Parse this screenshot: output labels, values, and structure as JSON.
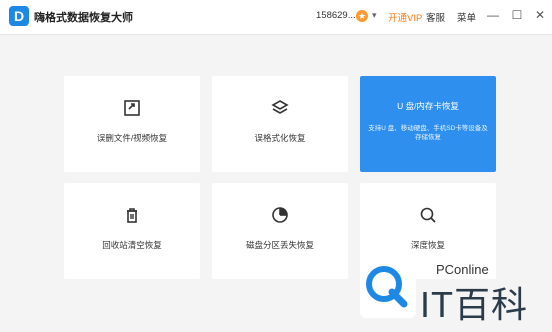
{
  "window": {
    "title": "嗨格式数据恢复大师",
    "account": "158629...",
    "vip_label": "开通VIP",
    "menu_1": "客服",
    "menu_2": "菜单"
  },
  "cards": [
    {
      "label": "误删文件/视频恢复",
      "icon": "file-restore-icon"
    },
    {
      "label": "误格式化恢复",
      "icon": "layers-icon"
    },
    {
      "title": "U 盘/内存卡恢复",
      "description": "支持U 盘、移动硬盘、手机SD卡等设备及存储恢复",
      "icon": "usb-card-icon"
    },
    {
      "label": "回收站清空恢复",
      "icon": "trash-icon"
    },
    {
      "label": "磁盘分区丢失恢复",
      "icon": "disk-partition-icon"
    },
    {
      "label": "深度恢复",
      "icon": "magnifier-icon"
    }
  ],
  "watermark": {
    "brand": "PConline",
    "name": "IT百科"
  },
  "colors": {
    "accent": "#2f8fef",
    "vip": "#ff7f1a"
  }
}
